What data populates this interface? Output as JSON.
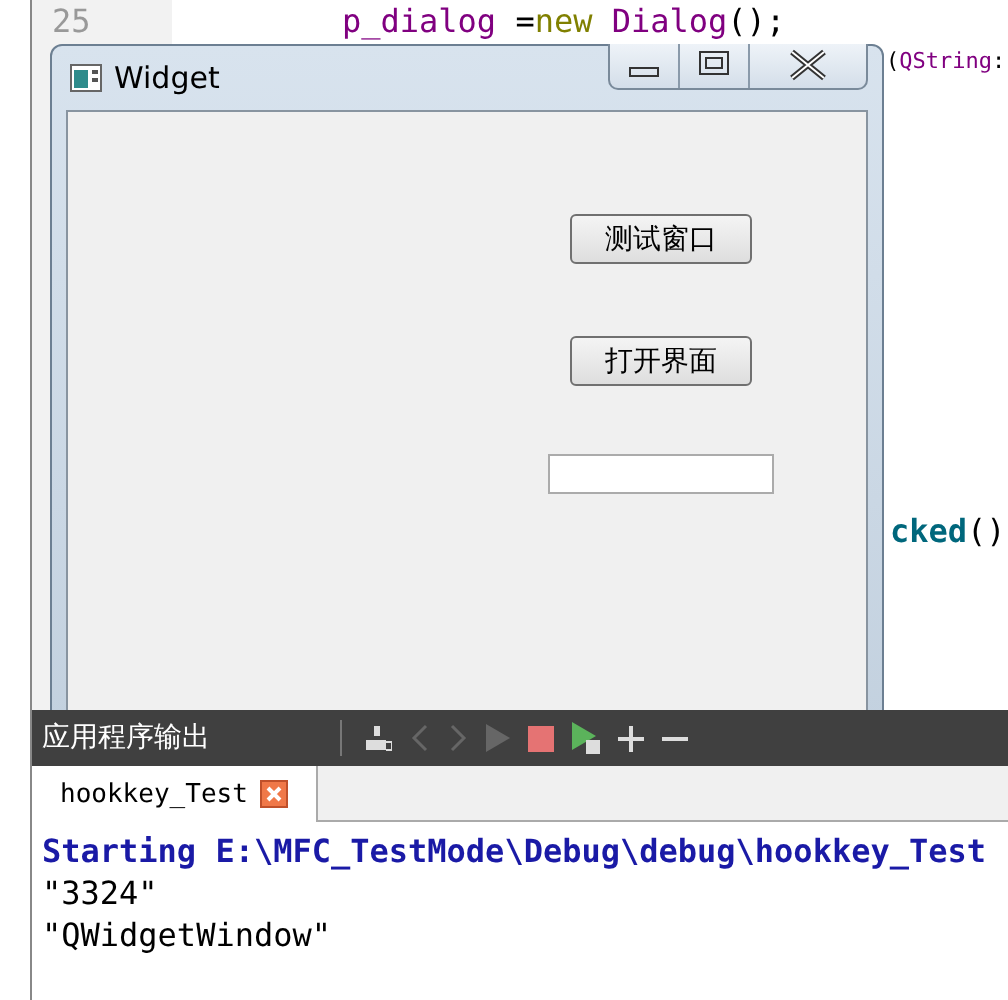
{
  "editor": {
    "line_numbers": [
      "25"
    ],
    "code_fragments": [
      {
        "kind": "line25",
        "tokens": [
          {
            "kind": "ident",
            "text": "p_dialog"
          },
          {
            "kind": "plain",
            "text": " ="
          },
          {
            "kind": "keyword",
            "text": "new"
          },
          {
            "kind": "ident",
            "text": " Dialog"
          },
          {
            "kind": "plain",
            "text": "();"
          }
        ]
      },
      {
        "kind": "line26",
        "tokens": [
          {
            "kind": "plain",
            "text": "("
          },
          {
            "kind": "ident",
            "text": "QString"
          },
          {
            "kind": "plain",
            "text": ":"
          }
        ]
      },
      {
        "kind": "slot",
        "tokens": [
          {
            "kind": "call",
            "text": "cked"
          },
          {
            "kind": "plain",
            "text": "()"
          }
        ]
      }
    ]
  },
  "window": {
    "title": "Widget",
    "buttons": [
      "测试窗口",
      "打开界面"
    ]
  },
  "output_pane": {
    "title": "应用程序输出",
    "tabs": [
      {
        "label": "hookkey_Test",
        "selected": true
      }
    ],
    "lines": [
      {
        "kind": "info",
        "text": "Starting E:\\MFC_TestMode\\Debug\\debug\\hookkey_Test"
      },
      {
        "kind": "plain",
        "text": "\"3324\""
      },
      {
        "kind": "plain",
        "text": "\"QWidgetWindow\""
      }
    ]
  }
}
